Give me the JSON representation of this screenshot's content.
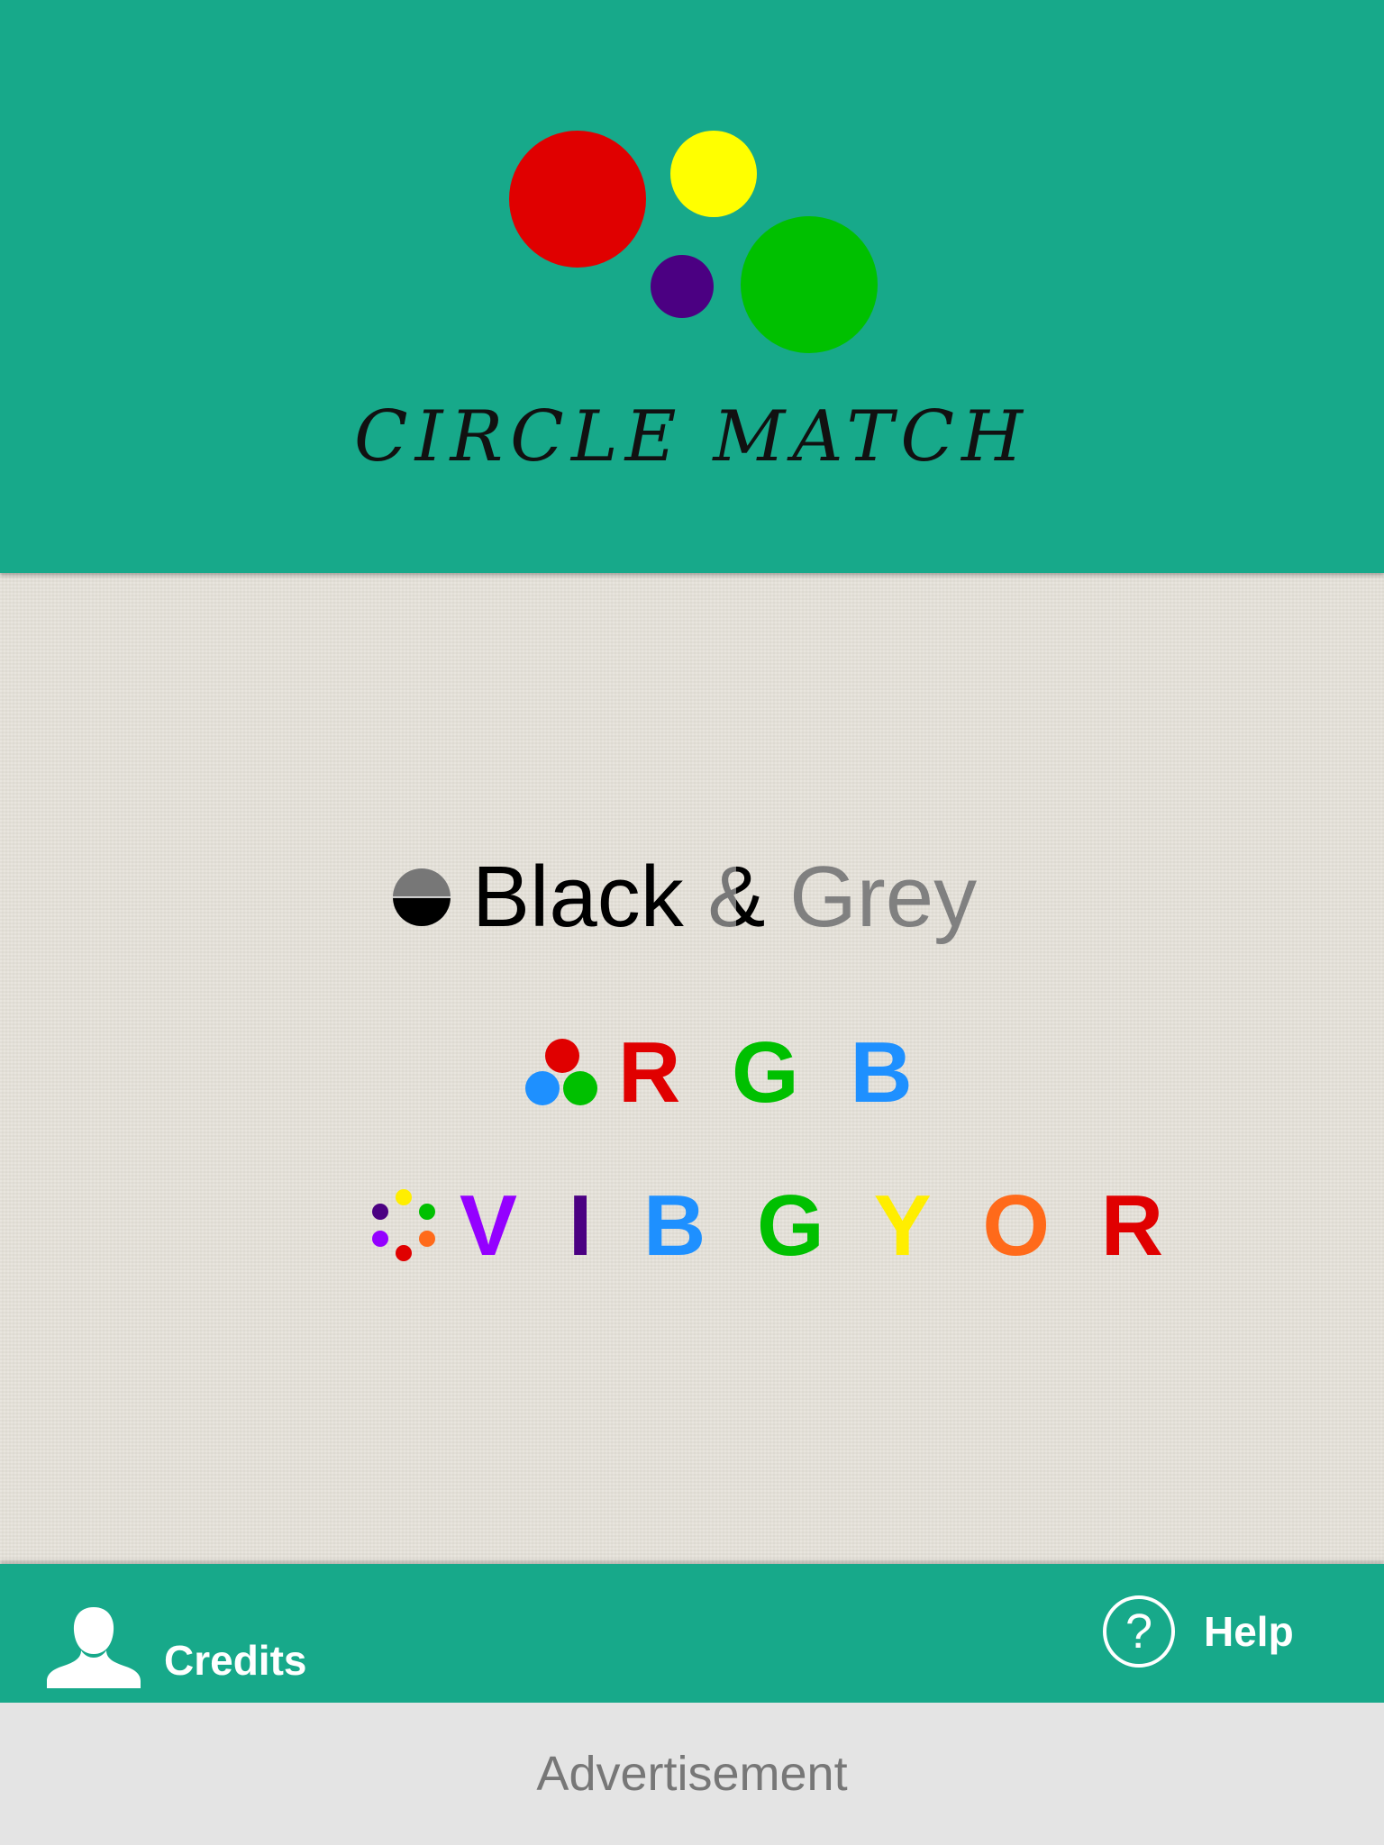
{
  "app": {
    "title": "CIRCLE MATCH",
    "logo_colors": [
      "#e00000",
      "#ffff00",
      "#4b0082",
      "#00c000"
    ]
  },
  "modes": {
    "black_grey": {
      "black": "Black",
      "amp": "&",
      "grey": "Grey",
      "icon": "half-circle-icon"
    },
    "rgb": {
      "letters": [
        "R",
        "G",
        "B"
      ],
      "colors": [
        "#e00000",
        "#00c000",
        "#1e90ff"
      ],
      "icon": "three-dot-icon"
    },
    "vibgyor": {
      "letters": [
        "V",
        "I",
        "B",
        "G",
        "Y",
        "O",
        "R"
      ],
      "colors": [
        "#9400ff",
        "#4b0082",
        "#1e90ff",
        "#00c000",
        "#ffee00",
        "#ff6a1a",
        "#e00000"
      ],
      "icon": "seven-dot-icon"
    }
  },
  "footer": {
    "credits_label": "Credits",
    "help_label": "Help",
    "credits_icon": "person-icon",
    "help_icon": "question-circle-icon"
  },
  "ad": {
    "label": "Advertisement"
  }
}
